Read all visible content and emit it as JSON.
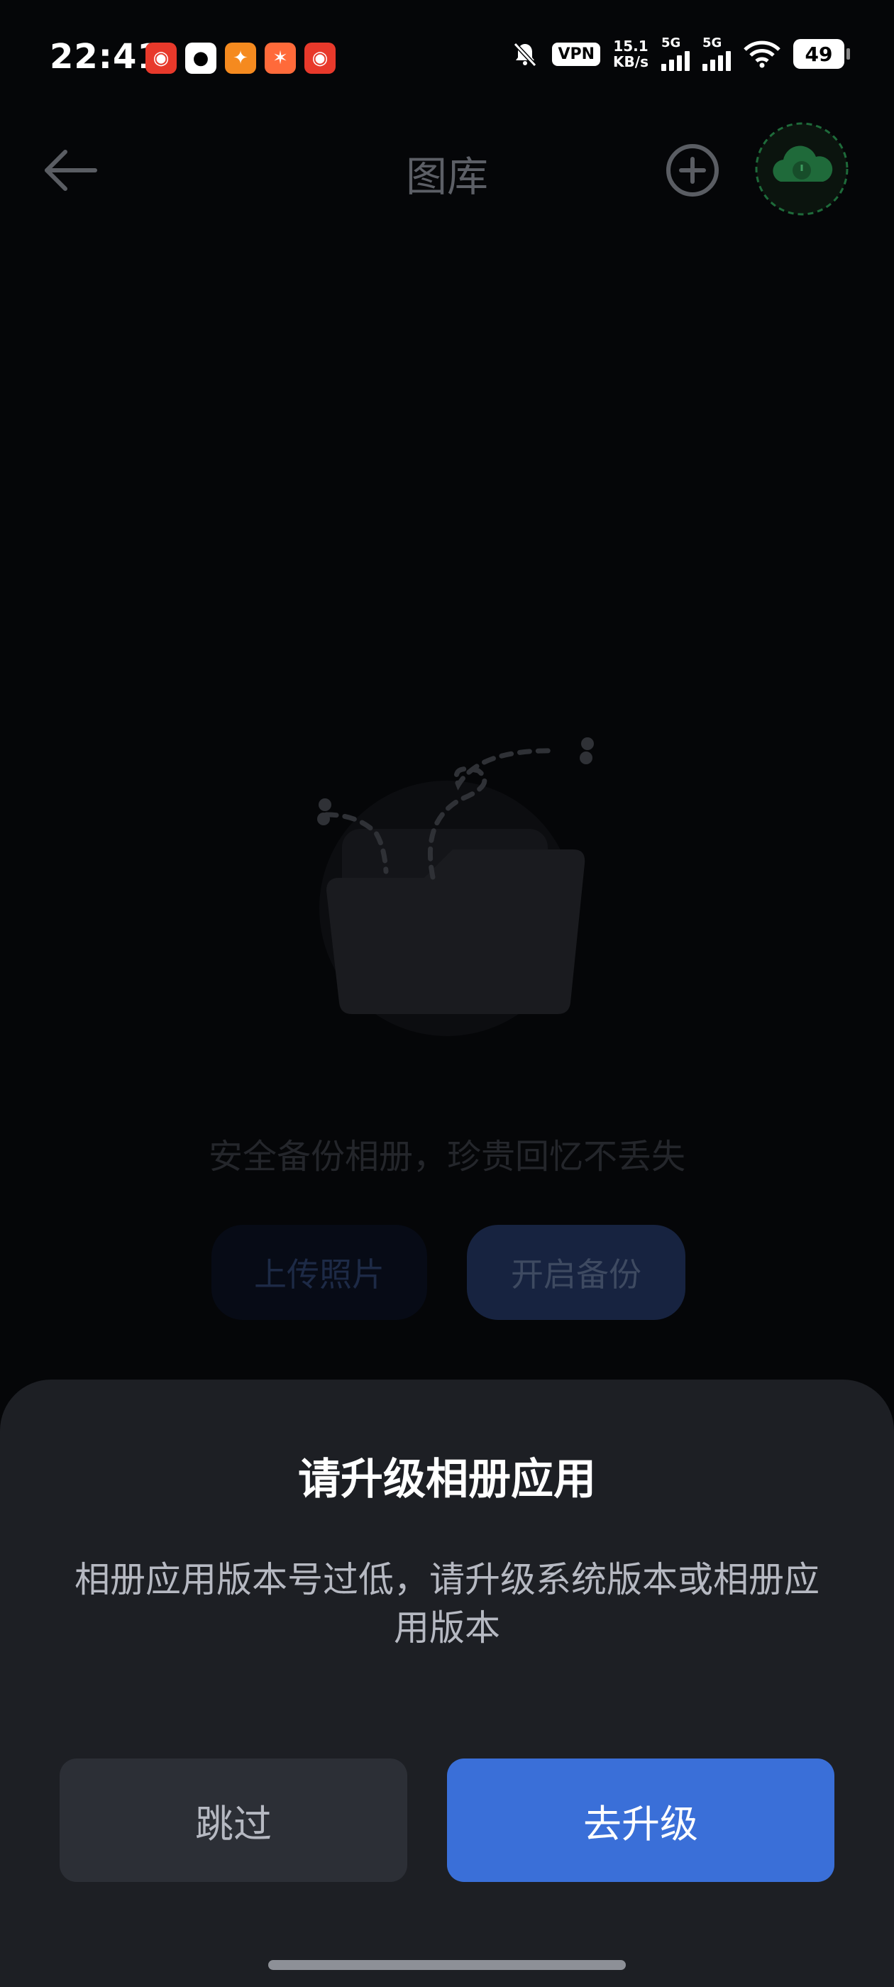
{
  "status_bar": {
    "time": "22:41",
    "app_icons": [
      "netease-music-icon",
      "qq-icon",
      "orange-app-icon",
      "orange-app-icon",
      "netease-music-icon"
    ],
    "vpn": "VPN",
    "speed_value": "15.1",
    "speed_unit": "KB/s",
    "signal_1_label": "5G",
    "signal_2_label": "5G",
    "battery": "49"
  },
  "header": {
    "title": "图库"
  },
  "empty_state": {
    "message": "安全备份相册，珍贵回忆不丢失",
    "upload_label": "上传照片",
    "backup_label": "开启备份"
  },
  "dialog": {
    "title": "请升级相册应用",
    "message": "相册应用版本号过低，请升级系统版本或相册应用版本",
    "skip_label": "跳过",
    "upgrade_label": "去升级"
  },
  "colors": {
    "background": "#050608",
    "sheet": "#1d1f24",
    "primary": "#3a6fd8",
    "secondary_button": "#2c2f36",
    "cloud_green": "#1e6b3a"
  }
}
